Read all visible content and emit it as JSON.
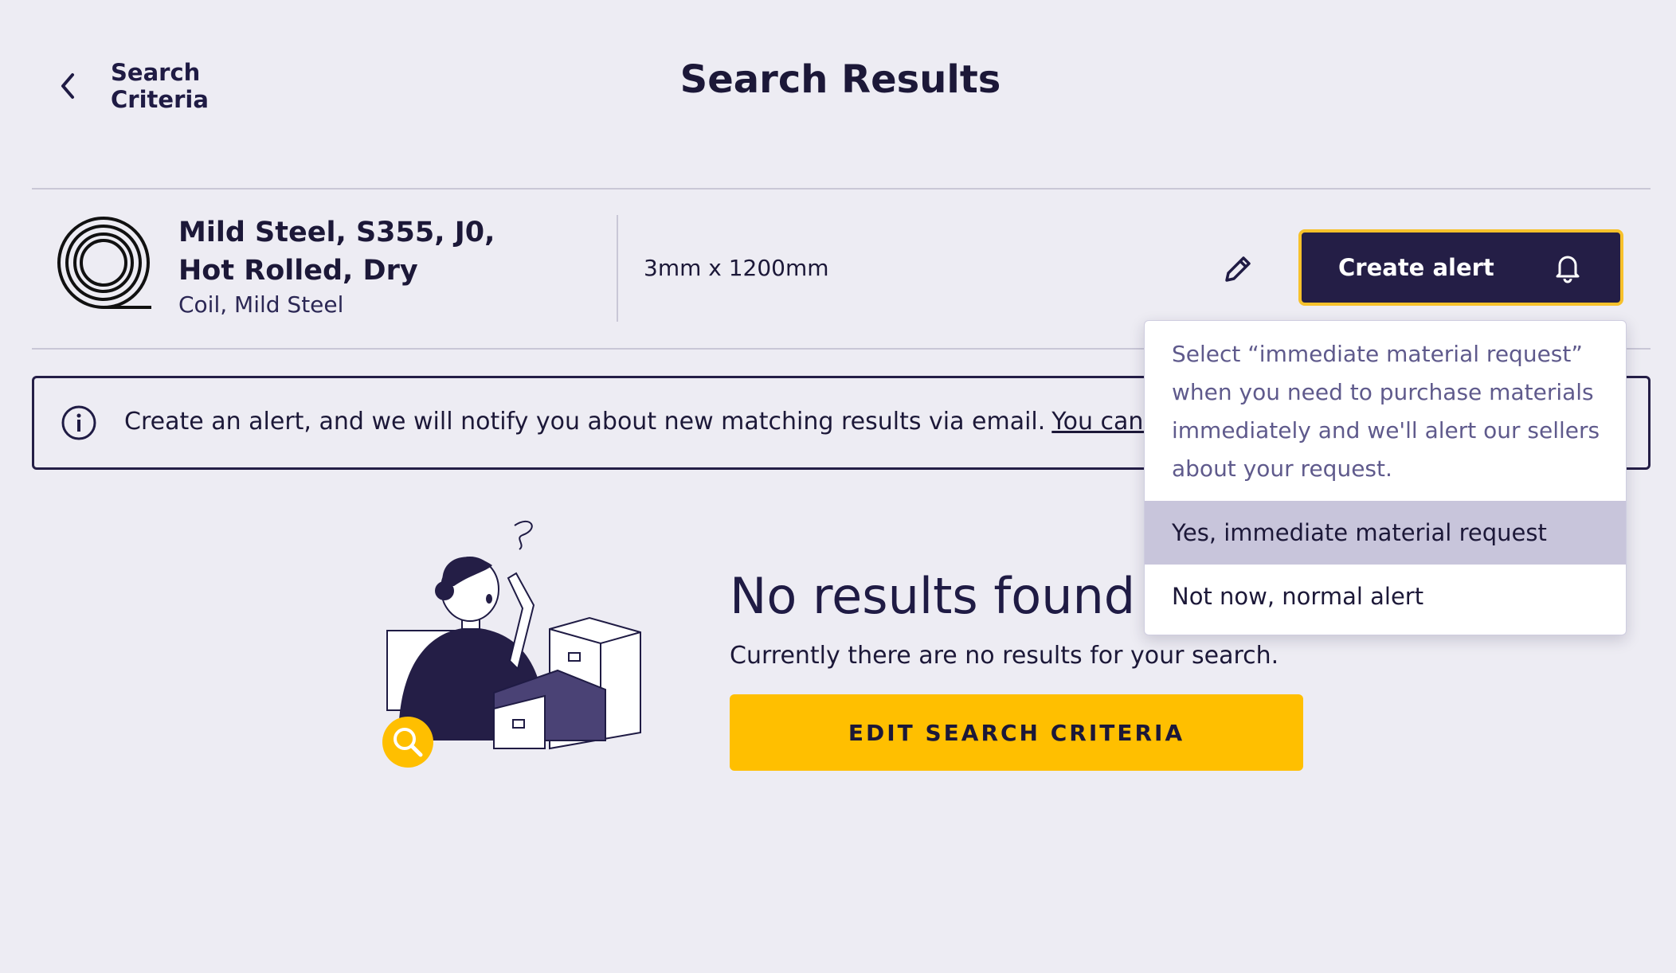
{
  "header": {
    "back_label": "Search Criteria",
    "title": "Search Results"
  },
  "product": {
    "name": "Mild Steel, S355, J0, Hot Rolled, Dry",
    "subtitle": "Coil, Mild Steel",
    "dimensions": "3mm x 1200mm",
    "icon": "coil-icon"
  },
  "actions": {
    "edit_icon": "pencil-icon",
    "create_alert_label": "Create alert",
    "create_alert_icon": "bell-icon"
  },
  "banner": {
    "text": "Create an alert, and we will notify you about new matching results via email.",
    "link_text": "You can find you"
  },
  "dropdown": {
    "description": "Select “immediate material request” when you need to purchase materials immediately and we'll alert our sellers about your request.",
    "options": [
      {
        "label": "Yes, immediate material request",
        "highlighted": true
      },
      {
        "label": "Not now, normal alert",
        "highlighted": false
      }
    ]
  },
  "empty_state": {
    "title": "No results found",
    "text": "Currently there are no results for your search.",
    "button_label": "EDIT SEARCH CRITERIA"
  },
  "colors": {
    "navy": "#241e46",
    "accent_yellow": "#ffbf00",
    "background": "#edecf3",
    "highlight": "#c8c5db"
  }
}
